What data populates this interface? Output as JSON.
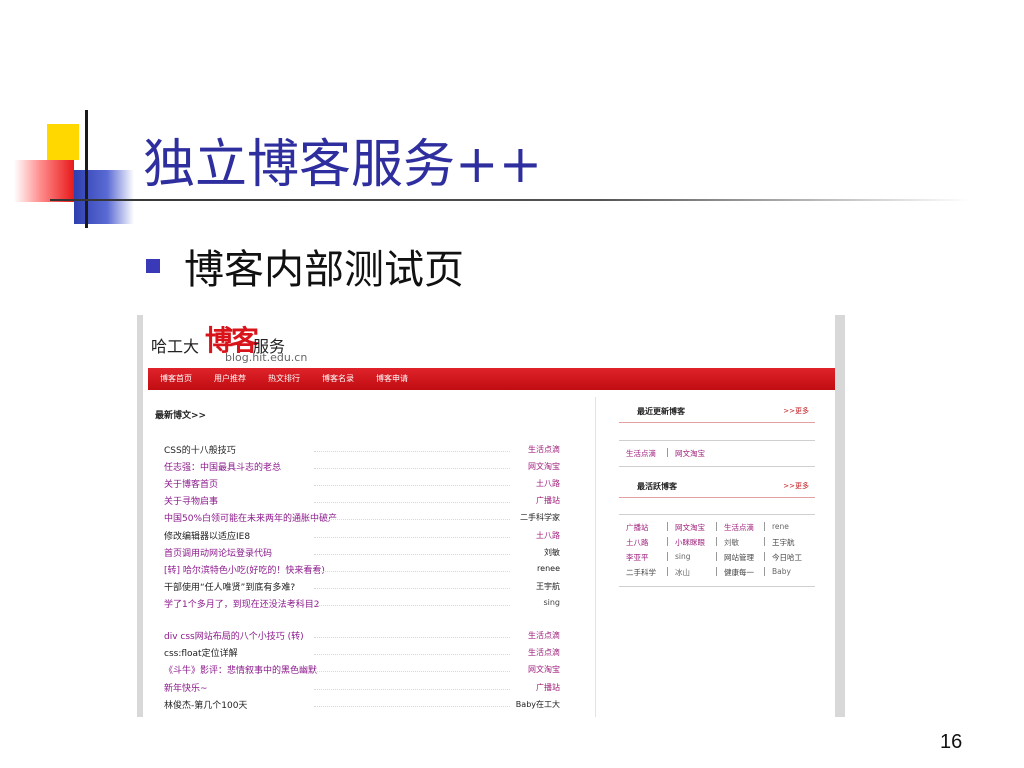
{
  "slide": {
    "title": "独立博客服务++",
    "bullet": "博客内部测试页",
    "page_number": "16"
  },
  "blog": {
    "logo": {
      "prefix": "哈工大",
      "mark": "博客",
      "suffix": "服务",
      "url": "blog.hit.edu.cn"
    },
    "nav": [
      "博客首页",
      "用户推荐",
      "热文排行",
      "博客名录",
      "博客申请"
    ],
    "latest_title": "最新博文>>",
    "posts_group1": [
      {
        "title": "CSS的十八般技巧",
        "author": "生活点滴",
        "title_color": "#222222",
        "author_color": "#a0207d"
      },
      {
        "title": "任志强：中国最具斗志的老总",
        "author": "网文淘宝",
        "title_color": "#8c1a8c",
        "author_color": "#a0207d"
      },
      {
        "title": "关于博客首页",
        "author": "土八路",
        "title_color": "#8c1a8c",
        "author_color": "#a0207d"
      },
      {
        "title": "关于寻物启事",
        "author": "广播站",
        "title_color": "#8c1a8c",
        "author_color": "#a0207d"
      },
      {
        "title": "中国50%白领可能在未来两年的通胀中破产",
        "author": "二手科学家",
        "title_color": "#8c1a8c",
        "author_color": "#222222"
      },
      {
        "title": "修改编辑器以适应IE8",
        "author": "土八路",
        "title_color": "#222222",
        "author_color": "#a0207d"
      },
      {
        "title": "首页调用动网论坛登录代码",
        "author": "刘敏",
        "title_color": "#8c1a8c",
        "author_color": "#222222"
      },
      {
        "title": "[转] 哈尔滨特色小吃(好吃的！快来看看)",
        "author": "renee",
        "title_color": "#8c1a8c",
        "author_color": "#222222"
      },
      {
        "title": "干部使用“任人唯贤”到底有多难?",
        "author": "王宇航",
        "title_color": "#222222",
        "author_color": "#222222"
      },
      {
        "title": "学了1个多月了，到现在还没法考科目2",
        "author": "sing",
        "title_color": "#8c1a8c",
        "author_color": "#444444"
      }
    ],
    "posts_group2": [
      {
        "title": "div css网站布局的八个小技巧 (转)",
        "author": "生活点滴",
        "title_color": "#8c1a8c",
        "author_color": "#a0207d"
      },
      {
        "title": "css:float定位详解",
        "author": "生活点滴",
        "title_color": "#222222",
        "author_color": "#a0207d"
      },
      {
        "title": "《斗牛》影评：悲情叙事中的黑色幽默",
        "author": "网文淘宝",
        "title_color": "#8c1a8c",
        "author_color": "#a0207d"
      },
      {
        "title": "新年快乐~",
        "author": "广播站",
        "title_color": "#8c1a8c",
        "author_color": "#a0207d"
      },
      {
        "title": "林俊杰-第几个100天",
        "author": "Baby在工大",
        "title_color": "#222222",
        "author_color": "#222222"
      }
    ],
    "recent_updated": {
      "title": "最近更新博客",
      "more": ">>更多",
      "items": [
        "生活点滴",
        "网文淘宝"
      ]
    },
    "most_active": {
      "title": "最活跃博客",
      "more": ">>更多",
      "rows": [
        [
          "广播站",
          "网文淘宝",
          "生活点滴",
          "rene"
        ],
        [
          "土八路",
          "小眯眯眼",
          "刘敏",
          "王宇航"
        ],
        [
          "李亚平",
          "sing",
          "网站管理",
          "今日哈工"
        ],
        [
          "二手科学",
          "冰山",
          "健康每一",
          "Baby"
        ]
      ],
      "colors": [
        [
          "#a0207d",
          "#a0207d",
          "#a0207d",
          "#666666"
        ],
        [
          "#a0207d",
          "#a0207d",
          "#666666",
          "#444444"
        ],
        [
          "#a0207d",
          "#666666",
          "#444444",
          "#444444"
        ],
        [
          "#444444",
          "#666666",
          "#444444",
          "#666666"
        ]
      ]
    }
  }
}
